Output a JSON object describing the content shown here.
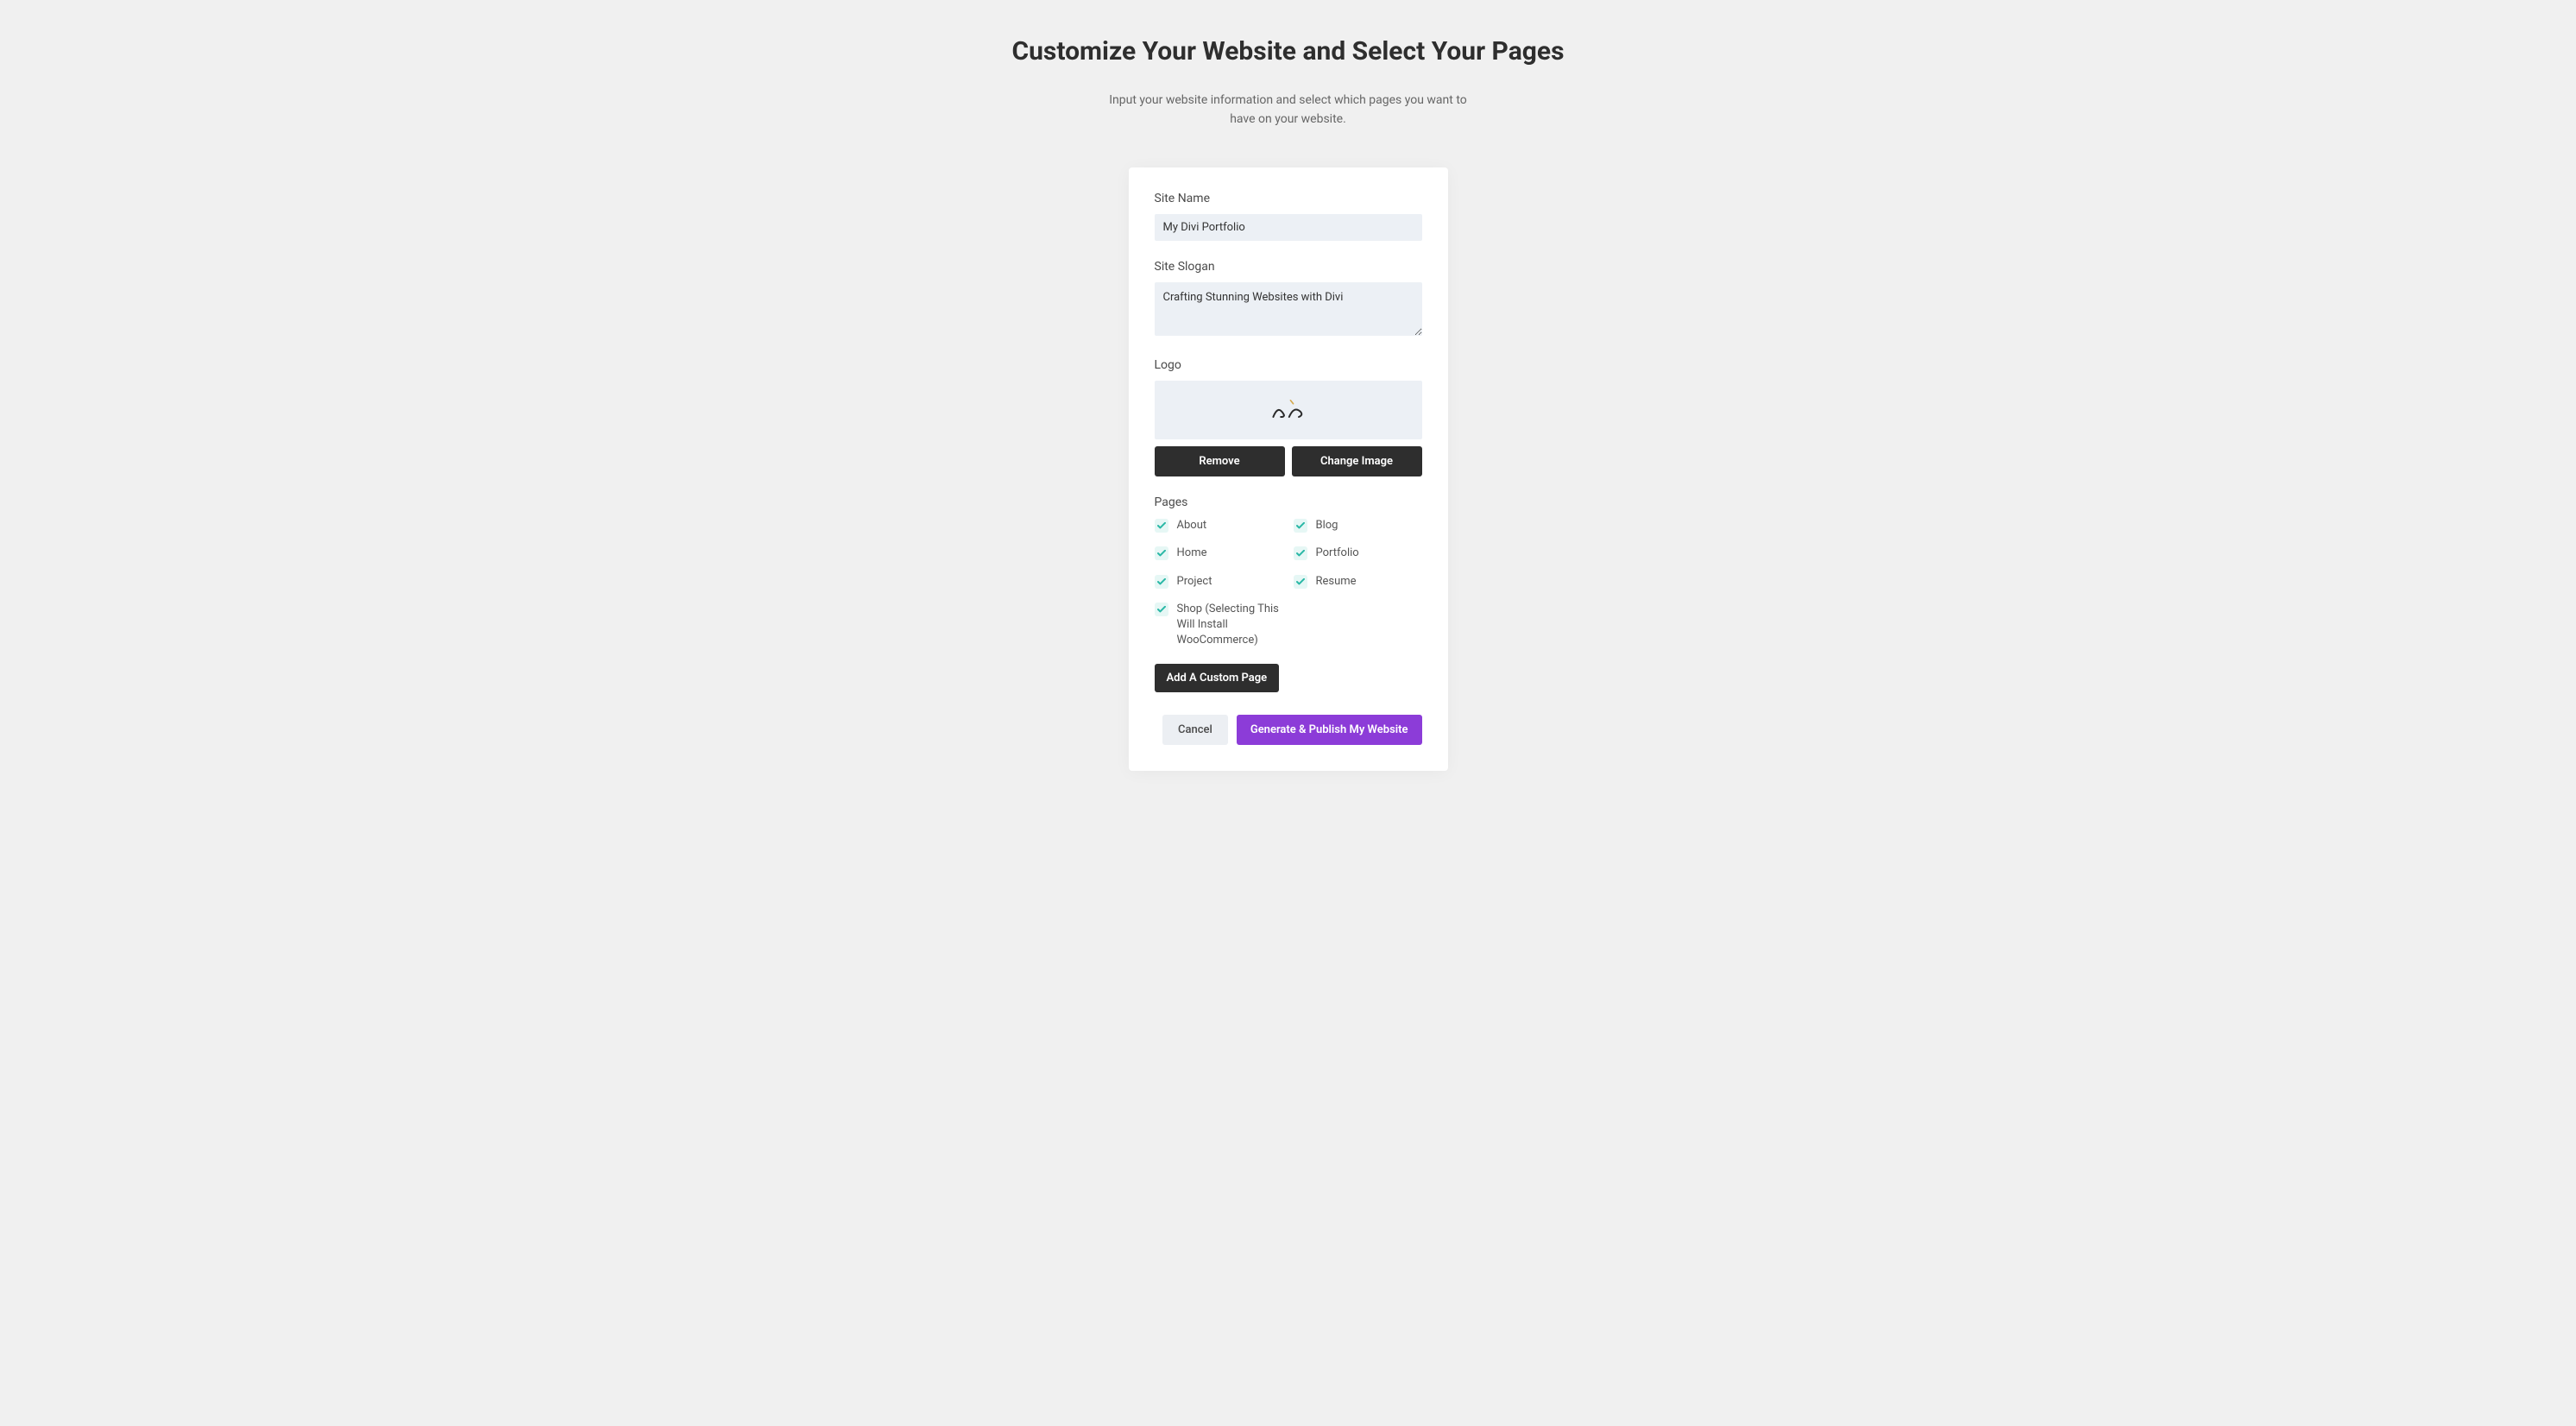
{
  "header": {
    "title": "Customize Your Website and Select Your Pages",
    "subtitle": "Input your website information and select which pages you want to have on your website."
  },
  "form": {
    "siteName": {
      "label": "Site Name",
      "value": "My Divi Portfolio"
    },
    "siteSlogan": {
      "label": "Site Slogan",
      "value": "Crafting Stunning Websites with Divi"
    },
    "logo": {
      "label": "Logo",
      "removeButton": "Remove",
      "changeButton": "Change Image"
    },
    "pages": {
      "label": "Pages",
      "items": [
        {
          "label": "About",
          "checked": true
        },
        {
          "label": "Blog",
          "checked": true
        },
        {
          "label": "Home",
          "checked": true
        },
        {
          "label": "Portfolio",
          "checked": true
        },
        {
          "label": "Project",
          "checked": true
        },
        {
          "label": "Resume",
          "checked": true
        },
        {
          "label": "Shop (Selecting This Will Install WooCommerce)",
          "checked": true
        }
      ],
      "addButton": "Add A Custom Page"
    }
  },
  "footer": {
    "cancelButton": "Cancel",
    "submitButton": "Generate & Publish My Website"
  }
}
